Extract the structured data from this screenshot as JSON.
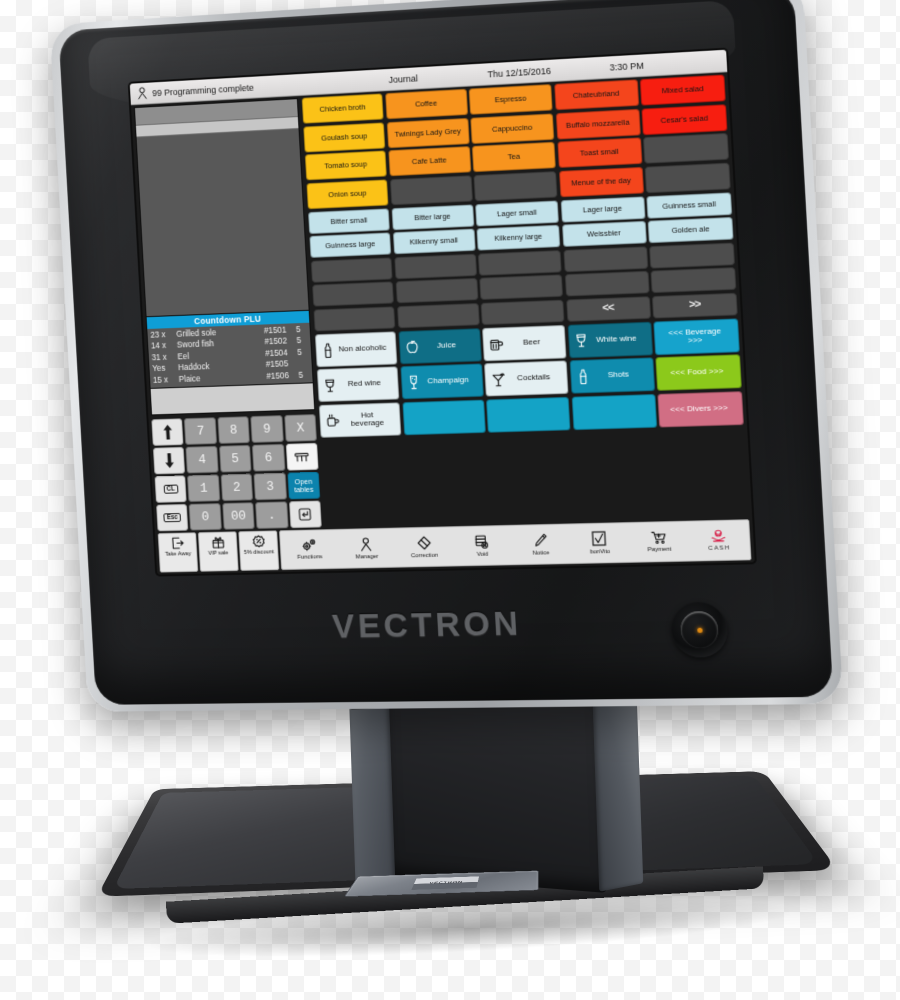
{
  "device": {
    "brand": "VECTRON",
    "base_badge": "VECTRON"
  },
  "statusbar": {
    "user_status": "99  Programming complete",
    "journal": "Journal",
    "date": "Thu 12/15/2016",
    "time": "3:30 PM"
  },
  "countdown": {
    "title": "Countdown PLU",
    "rows": [
      {
        "qty": "23 x",
        "name": "Grilled sole",
        "plu": "#1501",
        "num": "5"
      },
      {
        "qty": "14 x",
        "name": "Sword fish",
        "plu": "#1502",
        "num": "5"
      },
      {
        "qty": "31 x",
        "name": "Eel",
        "plu": "#1504",
        "num": "5"
      },
      {
        "qty": "Yes",
        "name": "Haddock",
        "plu": "#1505",
        "num": ""
      },
      {
        "qty": "15 x",
        "name": "Plaice",
        "plu": "#1506",
        "num": "5"
      }
    ]
  },
  "keypad": {
    "keys": [
      {
        "label": "↑",
        "style": "light",
        "icon": "arrow-up-icon"
      },
      {
        "label": "7",
        "style": "gray"
      },
      {
        "label": "8",
        "style": "gray"
      },
      {
        "label": "9",
        "style": "gray"
      },
      {
        "label": "X",
        "style": "gray"
      },
      {
        "label": "↓",
        "style": "light",
        "icon": "arrow-down-icon"
      },
      {
        "label": "4",
        "style": "gray"
      },
      {
        "label": "5",
        "style": "gray"
      },
      {
        "label": "6",
        "style": "gray"
      },
      {
        "label": "",
        "style": "white",
        "icon": "table-icon"
      },
      {
        "label": "CL",
        "style": "light",
        "boxed": true
      },
      {
        "label": "1",
        "style": "gray"
      },
      {
        "label": "2",
        "style": "gray"
      },
      {
        "label": "3",
        "style": "gray"
      },
      {
        "label": "Open tables",
        "style": "teal"
      },
      {
        "label": "Esc",
        "style": "light",
        "boxed": true
      },
      {
        "label": "0",
        "style": "gray"
      },
      {
        "label": "00",
        "style": "gray"
      },
      {
        "label": ".",
        "style": "gray"
      },
      {
        "label": "",
        "style": "light",
        "icon": "enter-icon"
      }
    ]
  },
  "food_grid": {
    "cells": [
      {
        "label": "Chicken broth",
        "color": "#FBC217"
      },
      {
        "label": "Coffee",
        "color": "#F7941E"
      },
      {
        "label": "Espresso",
        "color": "#F7941E"
      },
      {
        "label": "Chateubriand",
        "color": "#F4451C"
      },
      {
        "label": "Mixed salad",
        "color": "#F71E10"
      },
      {
        "label": "Goulash soup",
        "color": "#FBC217"
      },
      {
        "label": "Twinings Lady Grey",
        "color": "#F7941E"
      },
      {
        "label": "Cappuccino",
        "color": "#F7941E"
      },
      {
        "label": "Buffalo mozzarella",
        "color": "#F4451C"
      },
      {
        "label": "Cesar's salad",
        "color": "#F71E10"
      },
      {
        "label": "Tomato soup",
        "color": "#FBC217"
      },
      {
        "label": "Cafe Latte",
        "color": "#F7941E"
      },
      {
        "label": "Tea",
        "color": "#F7941E"
      },
      {
        "label": "Toast small",
        "color": "#F4451C"
      },
      {
        "label": "",
        "color": ""
      },
      {
        "label": "Onion soup",
        "color": "#FBC217"
      },
      {
        "label": "",
        "color": ""
      },
      {
        "label": "",
        "color": ""
      },
      {
        "label": "Menue of the day",
        "color": "#F4451C"
      },
      {
        "label": "",
        "color": ""
      }
    ]
  },
  "beer_grid": {
    "cells": [
      {
        "label": "Bitter small",
        "color": "#C3E2EA"
      },
      {
        "label": "Bitter large",
        "color": "#C3E2EA"
      },
      {
        "label": "Lager small",
        "color": "#C3E2EA"
      },
      {
        "label": "Lager large",
        "color": "#C3E2EA"
      },
      {
        "label": "Guinness small",
        "color": "#C3E2EA"
      },
      {
        "label": "Guinness large",
        "color": "#C3E2EA"
      },
      {
        "label": "Kilkenny small",
        "color": "#C3E2EA"
      },
      {
        "label": "Kilkenny large",
        "color": "#C3E2EA"
      },
      {
        "label": "Weissbier",
        "color": "#C3E2EA"
      },
      {
        "label": "Golden ale",
        "color": "#C3E2EA"
      },
      {
        "label": "",
        "color": ""
      },
      {
        "label": "",
        "color": ""
      },
      {
        "label": "",
        "color": ""
      },
      {
        "label": "",
        "color": ""
      },
      {
        "label": "",
        "color": ""
      },
      {
        "label": "",
        "color": ""
      },
      {
        "label": "",
        "color": ""
      },
      {
        "label": "",
        "color": ""
      },
      {
        "label": "",
        "color": ""
      },
      {
        "label": "",
        "color": ""
      },
      {
        "label": "",
        "color": ""
      },
      {
        "label": "",
        "color": ""
      },
      {
        "label": "",
        "color": ""
      },
      {
        "label": "<<",
        "color": "",
        "nav": true
      },
      {
        "label": ">>",
        "color": "",
        "nav": true
      }
    ]
  },
  "category_grid": {
    "cells": [
      {
        "label": "Non alcoholic",
        "color": "#E4EFF2",
        "text": "#141414",
        "icon": "bottle-icon"
      },
      {
        "label": "Juice",
        "color": "#0F6E86",
        "text": "#ffffff",
        "icon": "apple-icon"
      },
      {
        "label": "Beer",
        "color": "#E4EFF2",
        "text": "#141414",
        "icon": "beer-mug-icon"
      },
      {
        "label": "White wine",
        "color": "#0F6E86",
        "text": "#ffffff",
        "icon": "wine-glass-icon"
      },
      {
        "label": "<<< Beverage >>>",
        "color": "#16A3CC",
        "text": "#ffffff",
        "icon": ""
      },
      {
        "label": "Red wine",
        "color": "#E4EFF2",
        "text": "#141414",
        "icon": "wine-glass-icon"
      },
      {
        "label": "Champaign",
        "color": "#0F8CAE",
        "text": "#ffffff",
        "icon": "champagne-glass-icon"
      },
      {
        "label": "Cocktails",
        "color": "#E4EFF2",
        "text": "#141414",
        "icon": "cocktail-icon"
      },
      {
        "label": "Shots",
        "color": "#0F8CAE",
        "text": "#ffffff",
        "icon": "bottle-icon"
      },
      {
        "label": "<<< Food >>>",
        "color": "#8CC91B",
        "text": "#ffffff",
        "icon": ""
      },
      {
        "label": "Hot beverage",
        "color": "#E4EFF2",
        "text": "#141414",
        "icon": "coffee-cup-icon"
      },
      {
        "label": "",
        "color": "#14A3C6",
        "text": "#ffffff",
        "icon": ""
      },
      {
        "label": "",
        "color": "#14A3C6",
        "text": "#ffffff",
        "icon": ""
      },
      {
        "label": "",
        "color": "#14A3C6",
        "text": "#ffffff",
        "icon": ""
      },
      {
        "label": "<<< Divers >>>",
        "color": "#D16E84",
        "text": "#ffffff",
        "icon": ""
      }
    ]
  },
  "toolbar": {
    "small_buttons": [
      {
        "label": "Take Away",
        "icon": "takeaway-icon"
      },
      {
        "label": "VIP sale",
        "icon": "gift-icon"
      },
      {
        "label": "5% discount",
        "icon": "discount-icon"
      }
    ],
    "items": [
      {
        "label": "Functions",
        "icon": "gears-icon"
      },
      {
        "label": "Manager",
        "icon": "person-icon"
      },
      {
        "label": "Correction",
        "icon": "eraser-icon"
      },
      {
        "label": "Void",
        "icon": "void-icon"
      },
      {
        "label": "Notice",
        "icon": "pencil-icon"
      },
      {
        "label": "bonVito",
        "icon": "checkbox-icon"
      },
      {
        "label": "Payment",
        "icon": "cart-icon"
      },
      {
        "label": "CASH",
        "icon": "cash-hand-icon"
      }
    ]
  }
}
